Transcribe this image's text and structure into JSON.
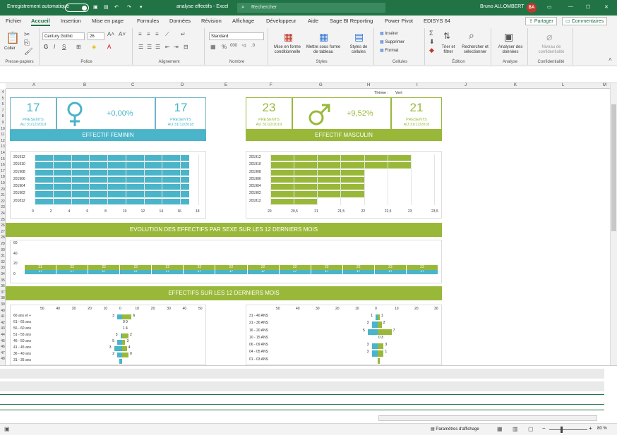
{
  "titlebar": {
    "autosave_label": "Enregistrement automatique",
    "filename": "analyse effectifs - Excel",
    "search_placeholder": "Rechercher",
    "user_name": "Bruno ALLOMBERT",
    "user_initials": "BA"
  },
  "tabs": [
    "Fichier",
    "Accueil",
    "Insertion",
    "Mise en page",
    "Formules",
    "Données",
    "Révision",
    "Affichage",
    "Développeur",
    "Aide",
    "Sage BI Reporting",
    "Power Pivot",
    "EDISYS 64"
  ],
  "active_tab": "Accueil",
  "share_label": "Partager",
  "comments_label": "Commentaires",
  "ribbon": {
    "clipboard": {
      "paste": "Coller",
      "label": "Presse-papiers"
    },
    "font": {
      "name": "Century Gothic",
      "size": "26",
      "label": "Police"
    },
    "alignment": {
      "label": "Alignement"
    },
    "number": {
      "format": "Standard",
      "label": "Nombre"
    },
    "styles": {
      "conditional": "Mise en forme conditionnelle",
      "table": "Mettre sous forme de tableau",
      "cell_styles": "Styles de cellules",
      "label": "Styles"
    },
    "cells": {
      "insert": "Insérer",
      "delete": "Supprimer",
      "format": "Format",
      "label": "Cellules"
    },
    "editing": {
      "sort": "Trier et filtrer",
      "find": "Rechercher et sélectionner",
      "label": "Édition"
    },
    "analysis": {
      "analyze": "Analyser des données",
      "label": "Analyse"
    },
    "confidentiality": {
      "level": "Niveau de confidentialité",
      "label": "Confidentialité"
    }
  },
  "columns": [
    "A",
    "B",
    "C",
    "D",
    "E",
    "F",
    "G",
    "H",
    "I",
    "J",
    "K",
    "L",
    "M"
  ],
  "rows": [
    "4",
    "5",
    "6",
    "7",
    "8",
    "9",
    "10",
    "11",
    "12",
    "13",
    "14",
    "15",
    "16",
    "17",
    "18",
    "19",
    "20",
    "21",
    "22",
    "23",
    "24",
    "25",
    "26",
    "27",
    "28",
    "29",
    "30",
    "31",
    "32",
    "33",
    "34",
    "35",
    "36",
    "37",
    "38",
    "39",
    "40",
    "41",
    "42",
    "43",
    "44",
    "45",
    "46",
    "47",
    "48"
  ],
  "theme_label": "Thème :",
  "theme_value": "Vert",
  "female": {
    "present_count": "17",
    "present_label": "PRESENTS",
    "date_label": "AU 31/12/2019",
    "variation": "+0,00%",
    "prev_count": "17",
    "prev_label": "PRESENTS",
    "prev_date": "AU 31/12/2018",
    "banner": "EFFECTIF FEMININ",
    "color": "#4ab4c9"
  },
  "male": {
    "present_count": "23",
    "present_label": "PRESENTS",
    "date_label": "AU 31/12/2019",
    "variation": "+9,52%",
    "prev_count": "21",
    "prev_label": "PRESENTS",
    "prev_date": "AU 31/12/2018",
    "banner": "EFFECTIF MASCULIN",
    "color": "#99b83a"
  },
  "banner_evolution": "EVOLUTION DES EFFECTIFS PAR SEXE SUR LES 12 DERNIERS MOIS",
  "banner_12months": "EFFECTIFS SUR LES 12 DERNIERS MOIS",
  "status": {
    "display_settings": "Paramètres d'affichage",
    "zoom": "80 %"
  },
  "chart_data": [
    {
      "type": "bar",
      "orientation": "horizontal",
      "categories": [
        "201912",
        "201910",
        "201908",
        "201906",
        "201904",
        "201902",
        "201812"
      ],
      "values": [
        17,
        17,
        17,
        17,
        17,
        17,
        17
      ],
      "xlim": [
        0,
        18
      ],
      "xticks": [
        "0",
        "2",
        "4",
        "6",
        "8",
        "10",
        "12",
        "14",
        "16",
        "18"
      ]
    },
    {
      "type": "bar",
      "orientation": "horizontal",
      "categories": [
        "201912",
        "201910",
        "201908",
        "201906",
        "201904",
        "201902",
        "201812"
      ],
      "values": [
        23,
        23,
        22,
        22,
        22,
        22,
        21
      ],
      "xlim": [
        20,
        23.5
      ],
      "xticks": [
        "20",
        "20,5",
        "21",
        "21,5",
        "22",
        "22,5",
        "23",
        "23,5"
      ]
    },
    {
      "type": "bar",
      "stacked": true,
      "categories": [
        "1",
        "2",
        "3",
        "4",
        "5",
        "6",
        "7",
        "8",
        "9",
        "10",
        "11",
        "12",
        "13"
      ],
      "series": [
        {
          "values": [
            17,
            17,
            17,
            17,
            17,
            17,
            17,
            17,
            17,
            17,
            17,
            17,
            17
          ]
        },
        {
          "values": [
            21,
            22,
            22,
            22,
            22,
            22,
            22,
            22,
            22,
            22,
            22,
            23,
            23
          ]
        }
      ],
      "ylim": [
        0,
        60
      ],
      "yticks": [
        "0",
        "20",
        "40",
        "60"
      ]
    },
    {
      "type": "bar",
      "orientation": "horizontal",
      "categories": [
        "66 ans et +",
        "61 - 65 ans",
        "56 - 60 ans",
        "51 - 55 ans",
        "46 - 50 ans",
        "41 - 45 ans",
        "36 - 40 ans",
        "31 - 35 ans"
      ],
      "series": [
        {
          "values": [
            3,
            0,
            0,
            1,
            3,
            5,
            3,
            2
          ]
        },
        {
          "values": [
            6,
            0,
            0,
            4,
            2,
            3,
            4,
            0
          ]
        }
      ],
      "data_labels": [
        "3",
        "6",
        "0",
        "0",
        "1",
        "4",
        "3",
        "2",
        "5",
        "3",
        "3",
        "4",
        "2",
        "0"
      ],
      "xticks": [
        "50",
        "40",
        "30",
        "20",
        "10",
        "0",
        "10",
        "20",
        "30",
        "40",
        "50"
      ]
    },
    {
      "type": "bar",
      "orientation": "horizontal",
      "categories": [
        "31 - 40 ANS",
        "21 - 30 ANS",
        "16 - 20 ANS",
        "10 - 15 ANS",
        "06 - 09 ANS",
        "04 - 05 ANS",
        "01 - 03 ANS"
      ],
      "series": [
        {
          "values": [
            1,
            3,
            5,
            0,
            3,
            3,
            0
          ]
        },
        {
          "values": [
            1,
            2,
            7,
            0,
            3,
            3,
            1
          ]
        }
      ],
      "data_labels": [
        "1",
        "1",
        "3",
        "2",
        "5",
        "7",
        "0",
        "3",
        "3",
        "3",
        "3",
        "1"
      ],
      "xticks": [
        "50",
        "40",
        "30",
        "20",
        "10",
        "0",
        "10",
        "20",
        "30"
      ]
    }
  ]
}
